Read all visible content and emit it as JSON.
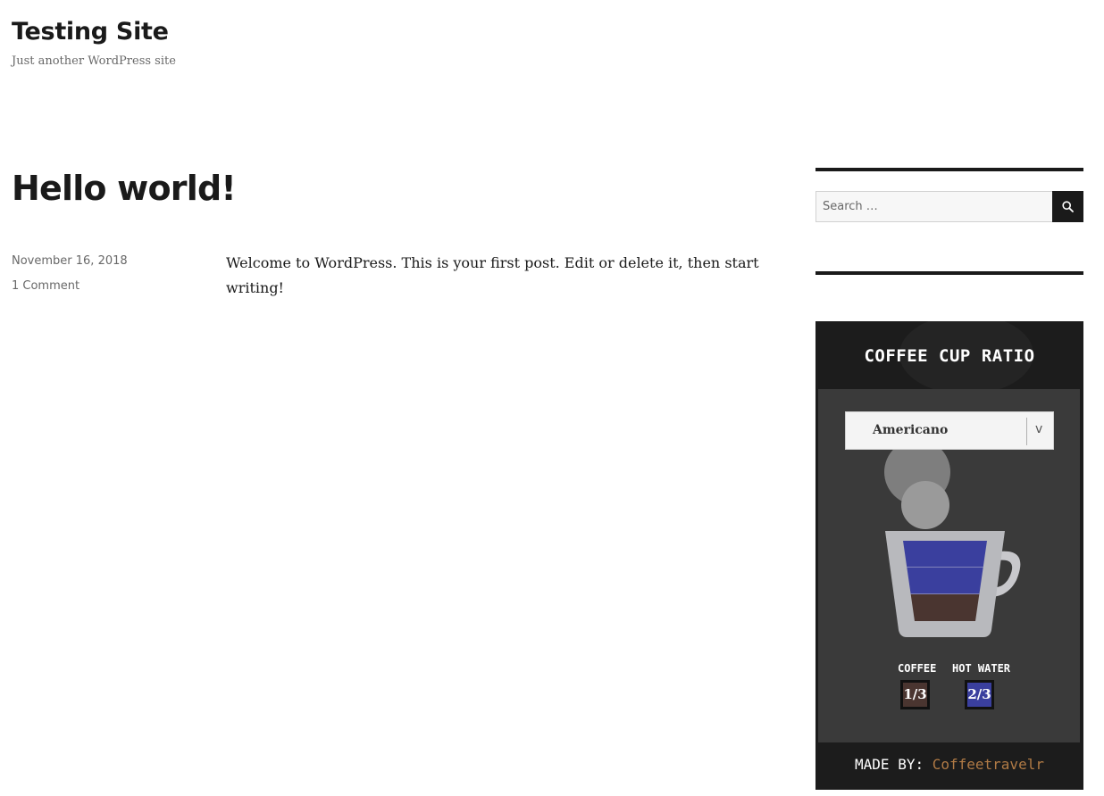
{
  "site": {
    "title": "Testing Site",
    "description": "Just another WordPress site"
  },
  "post": {
    "title": "Hello world!",
    "date": "November 16, 2018",
    "comments": "1 Comment",
    "content_lines": [
      "Welcome to WordPress. This is your first post. Edit or delete it, then start",
      "writing!"
    ]
  },
  "sidebar": {
    "search": {
      "placeholder": "Search …",
      "button_icon": "search-icon"
    },
    "coffee_widget": {
      "title": "COFFEE CUP RATIO",
      "selected_drink": "Americano",
      "select_arrow": "v",
      "ingredients": [
        {
          "name": "COFFEE",
          "ratio": "1/3",
          "color": "#4a3530"
        },
        {
          "name": "HOT WATER",
          "ratio": "2/3",
          "color": "#3a3f9e"
        }
      ],
      "cup_layers": [
        {
          "ingredient": "HOT WATER",
          "fraction": 0.3333,
          "color": "#3a3f9e"
        },
        {
          "ingredient": "HOT WATER",
          "fraction": 0.3333,
          "color": "#3a3f9e"
        },
        {
          "ingredient": "COFFEE",
          "fraction": 0.3333,
          "color": "#4a3530"
        }
      ],
      "footer_prefix": "MADE BY:",
      "footer_author": "Coffeetravelr",
      "author_color": "#b07a45"
    }
  }
}
